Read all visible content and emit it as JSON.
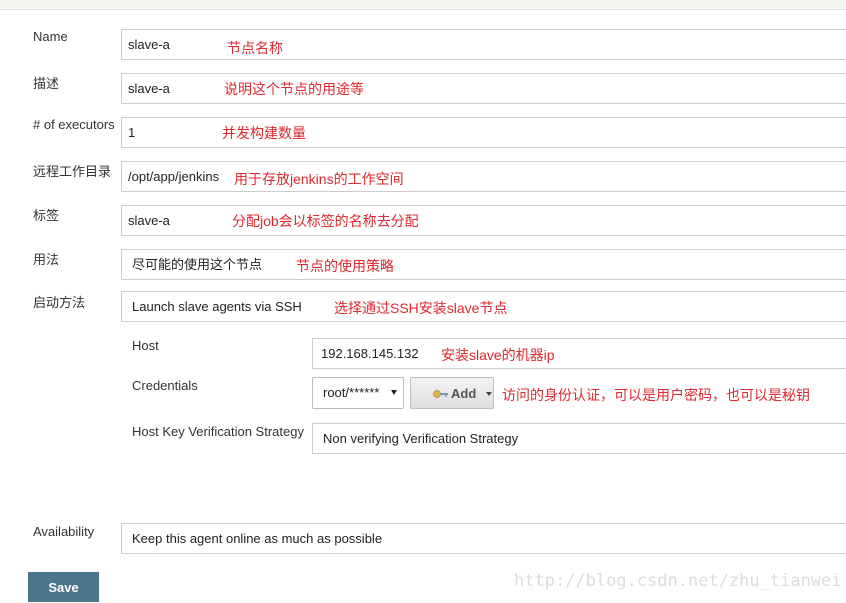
{
  "form": {
    "name": {
      "label": "Name",
      "value": "slave-a",
      "note": "节点名称"
    },
    "description": {
      "label": "描述",
      "value": "slave-a",
      "note": "说明这个节点的用途等"
    },
    "executors": {
      "label": "# of executors",
      "value": "1",
      "note": "并发构建数量"
    },
    "remote_root": {
      "label": "远程工作目录",
      "value": "/opt/app/jenkins",
      "note": "用于存放jenkins的工作空间"
    },
    "labels": {
      "label": "标签",
      "value": "slave-a",
      "note": "分配job会以标签的名称去分配"
    },
    "usage": {
      "label": "用法",
      "value": "尽可能的使用这个节点",
      "note": "节点的使用策略"
    },
    "launch": {
      "label": "启动方法",
      "value": "Launch slave agents via SSH",
      "note": "选择通过SSH安装slave节点"
    },
    "host": {
      "label": "Host",
      "value": "192.168.145.132",
      "note": "安装slave的机器ip"
    },
    "credentials": {
      "label": "Credentials",
      "value": "root/******",
      "add_label": "Add",
      "note": "访问的身份认证，可以是用户密码，也可以是秘钥"
    },
    "host_key": {
      "label": "Host Key Verification Strategy",
      "value": "Non verifying Verification Strategy"
    },
    "availability": {
      "label": "Availability",
      "value": "Keep this agent online as much as possible"
    },
    "save_label": "Save"
  },
  "watermark": "http://blog.csdn.net/zhu_tianwei",
  "colors": {
    "annotation": "#e0282e",
    "save_button": "#4b758b"
  },
  "icons": {
    "add_button": "key-icon"
  }
}
